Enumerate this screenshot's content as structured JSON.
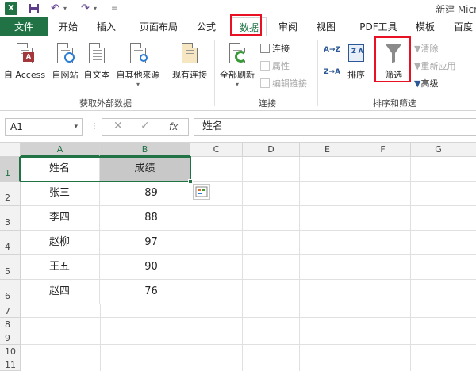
{
  "titlebar": {
    "app_icon": "X",
    "save_icon": "save-icon",
    "undo_icon": "↶",
    "redo_icon": "↷",
    "customize_icon": "=",
    "title": "新建 Micr"
  },
  "tabs": [
    {
      "id": "file",
      "label": "文件"
    },
    {
      "id": "home",
      "label": "开始"
    },
    {
      "id": "insert",
      "label": "插入"
    },
    {
      "id": "layout",
      "label": "页面布局"
    },
    {
      "id": "formulas",
      "label": "公式"
    },
    {
      "id": "data",
      "label": "数据",
      "active": true
    },
    {
      "id": "review",
      "label": "审阅"
    },
    {
      "id": "view",
      "label": "视图"
    },
    {
      "id": "pdf",
      "label": "PDF工具"
    },
    {
      "id": "template",
      "label": "模板"
    },
    {
      "id": "baidu",
      "label": "百度"
    }
  ],
  "ribbon": {
    "get_external": {
      "label": "获取外部数据",
      "buttons": [
        "自 Access",
        "自网站",
        "自文本",
        "自其他来源",
        "现有连接"
      ]
    },
    "connections": {
      "label": "连接",
      "refresh_all": "全部刷新",
      "connections": "连接",
      "properties": "属性",
      "edit_links": "编辑链接"
    },
    "sort_filter": {
      "label": "排序和筛选",
      "sort_az": "A→Z",
      "sort_za": "Z→A",
      "sort": "排序",
      "filter": "筛选",
      "clear": "清除",
      "reapply": "重新应用",
      "advanced": "高级"
    }
  },
  "formula_bar": {
    "name_box": "A1",
    "cancel_icon": "✕",
    "enter_icon": "✓",
    "fx_label": "fx",
    "content": "姓名"
  },
  "columns": [
    "A",
    "B",
    "C",
    "D",
    "E",
    "F",
    "G"
  ],
  "rows": [
    "1",
    "2",
    "3",
    "4",
    "5",
    "6",
    "7",
    "8",
    "9",
    "10",
    "11"
  ],
  "sheet": {
    "header": [
      "姓名",
      "成绩"
    ],
    "records": [
      {
        "name": "张三",
        "score": "89"
      },
      {
        "name": "李四",
        "score": "88"
      },
      {
        "name": "赵柳",
        "score": "97"
      },
      {
        "name": "王五",
        "score": "90"
      },
      {
        "name": "赵四",
        "score": "76"
      }
    ]
  },
  "colors": {
    "excel_green": "#217346",
    "highlight_red": "#e81123",
    "selected_fill": "#c8c8c8"
  }
}
